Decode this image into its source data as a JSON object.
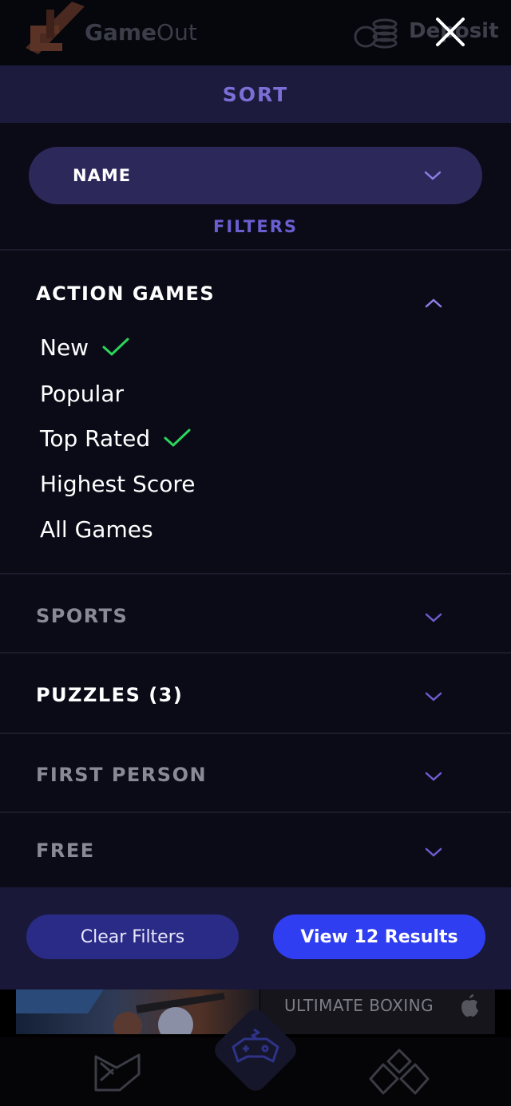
{
  "header": {
    "app_name_bold": "Game",
    "app_name_rest": "Out",
    "deposit_label": "Deposit",
    "logo_icon": "gameout-logo-icon",
    "coins_icon": "coins-icon",
    "close_icon": "close-icon"
  },
  "sort": {
    "title": "SORT",
    "selected": "NAME",
    "chevron_icon": "chevron-down-icon"
  },
  "filters": {
    "title": "FILTERS",
    "sections": [
      {
        "label": "ACTION GAMES",
        "expanded": true,
        "active": true,
        "options": [
          {
            "label": "New",
            "checked": true
          },
          {
            "label": "Popular",
            "checked": false
          },
          {
            "label": "Top Rated",
            "checked": true
          },
          {
            "label": "Highest Score",
            "checked": false
          },
          {
            "label": "All Games",
            "checked": false
          }
        ]
      },
      {
        "label": "SPORTS",
        "expanded": false,
        "active": false
      },
      {
        "label": "PUZZLES (3)",
        "expanded": false,
        "active": true
      },
      {
        "label": "FIRST PERSON",
        "expanded": false,
        "active": false
      },
      {
        "label": "FREE",
        "expanded": false,
        "active": false
      }
    ]
  },
  "actions": {
    "clear_label": "Clear Filters",
    "view_label": "View 12 Results"
  },
  "background": {
    "game_title": "ULTIMATE BOXING",
    "platform_icon": "apple-icon",
    "nav_icons": [
      "library-icon",
      "gamepad-icon",
      "diamond-icon"
    ]
  },
  "colors": {
    "accent": "#7a6fd6",
    "check": "#2bd65a",
    "primary_button": "#2f3ef0",
    "secondary_button": "#2a2b86",
    "panel_bg": "#0b0a17",
    "inactive_text": "#8a8a96"
  }
}
